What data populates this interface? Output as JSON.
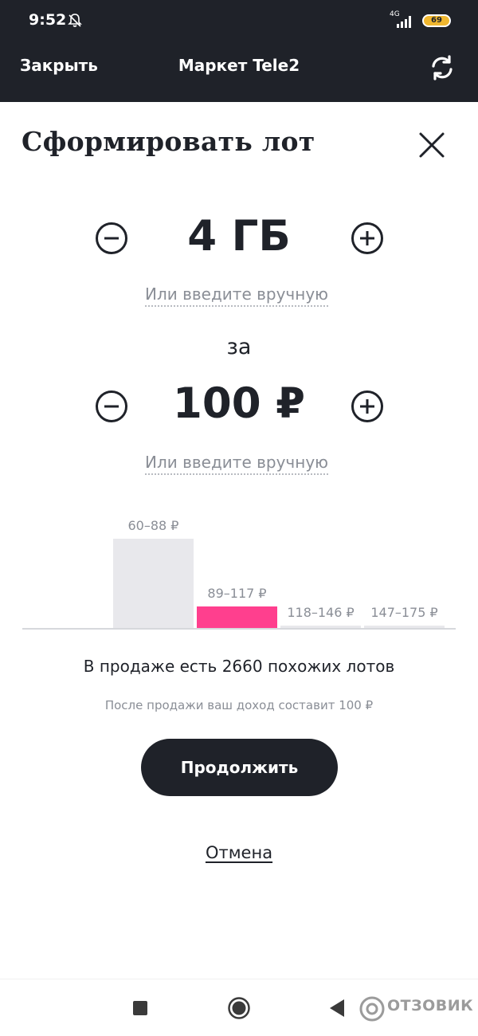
{
  "status_bar": {
    "time": "9:52",
    "network": "4G",
    "battery": "69",
    "icons": [
      "bell-off-icon",
      "signal-icon",
      "battery-icon"
    ]
  },
  "app_bar": {
    "close_label": "Закрыть",
    "title": "Маркет Tele2",
    "refresh_icon": "refresh-icon"
  },
  "sheet": {
    "title": "Сформировать лот",
    "volume": {
      "value": "4 ГБ",
      "manual_link": "Или введите вручную"
    },
    "separator": "за",
    "price": {
      "value": "100 ₽",
      "manual_link": "Или введите вручную"
    }
  },
  "chart_data": {
    "type": "bar",
    "categories": [
      "60–88 ₽",
      "89–117 ₽",
      "118–146 ₽",
      "147–175 ₽"
    ],
    "values": [
      112,
      27,
      3,
      3
    ],
    "highlight_index": 1,
    "colors": {
      "default": "#e8e8ec",
      "highlight": "#ff3f8e"
    }
  },
  "info": {
    "similar_lots": "В продаже есть 2660 похожих лотов",
    "income": "После продажи ваш доход составит 100 ₽"
  },
  "actions": {
    "continue_label": "Продолжить",
    "cancel_label": "Отмена"
  },
  "nav_bar": {
    "icons": [
      "recent-apps-icon",
      "home-icon",
      "back-icon"
    ],
    "watermark": "ОТЗОВИК"
  },
  "colors": {
    "dark": "#1f2229",
    "accent": "#ff3f8e",
    "muted": "#8a8e96",
    "battery": "#f0b72f"
  }
}
